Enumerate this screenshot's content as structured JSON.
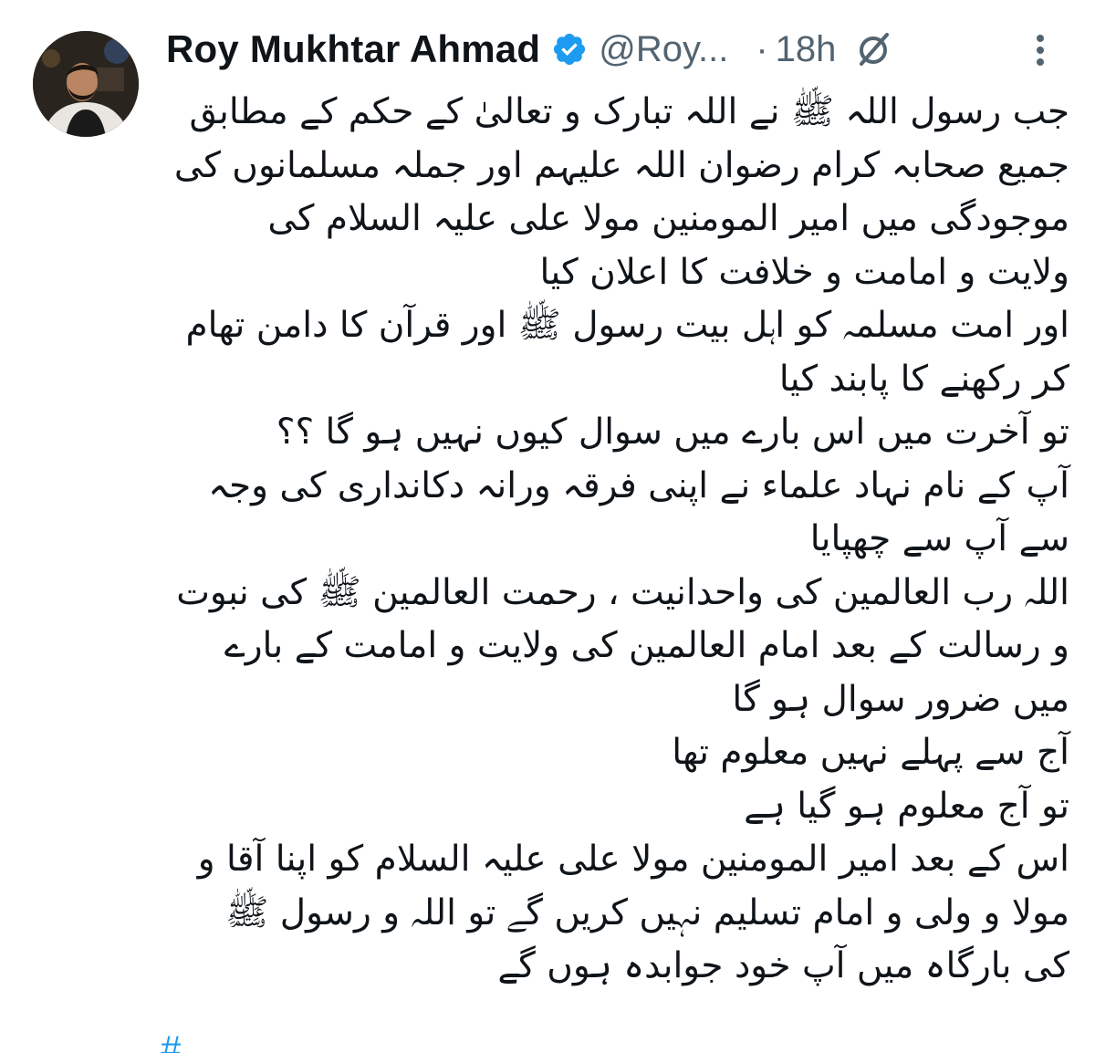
{
  "author": {
    "display_name": "Roy Mukhtar Ahmad",
    "handle": "@Roy...",
    "time": "18h",
    "verified": true,
    "verified_color": "#1d9bf0"
  },
  "icons": {
    "verified": "verified-badge-icon",
    "grok": "grok-icon",
    "more": "more-options-icon",
    "avatar": "profile-avatar"
  },
  "separator": "·",
  "tweet_lines": [
    "جب رسول اللہ ﷺ نے اللہ تبارک و تعالیٰ کے حکم کے مطابق",
    "جمیع صحابہ کرام رضوان اللہ علیہم اور جملہ مسلمانوں کی",
    "موجودگی میں امیر المومنین مولا علی علیہ السلام کی",
    "ولایت و امامت و خلافت کا اعلان کیا",
    "اور امت مسلمہ کو اہل بیت رسول ﷺ اور قرآن کا دامن تھام",
    "کر رکھنے کا پابند کیا",
    "تو آخرت میں اس بارے میں سوال کیوں نہیں ہو گا ؟؟",
    "آپ کے نام نہاد علماء نے اپنی فرقہ ورانہ دکانداری کی وجہ",
    "سے آپ سے چھپایا",
    "اللہ رب العالمین کی واحدانیت ، رحمت العالمین ﷺ کی نبوت",
    "و رسالت کے بعد امام العالمین کی ولایت و امامت کے بارے",
    "میں ضرور سوال ہو گا",
    "آج سے پہلے نہیں معلوم تھا",
    "تو آج معلوم ہو گیا ہے",
    "اس کے بعد امیر المومنین مولا علی علیہ السلام کو اپنا آقا و",
    "مولا و ولی و امام تسلیم نہیں کریں گے تو اللہ و رسول ﷺ",
    "کی بارگاہ میں آپ خود جوابدہ ہوں گے"
  ],
  "hashtag_peek": "#"
}
